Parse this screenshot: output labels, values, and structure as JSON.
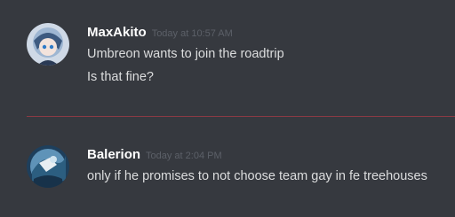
{
  "messages": [
    {
      "username": "MaxAkito",
      "timestamp": "Today at 10:57 AM",
      "lines": [
        "Umbreon wants to join the roadtrip",
        "Is that fine?"
      ],
      "avatar": "anime-character-avatar"
    },
    {
      "username": "Balerion",
      "timestamp": "Today at 2:04 PM",
      "lines": [
        "only if he promises to not choose team gay in fe treehouses"
      ],
      "avatar": "fantasy-art-avatar"
    }
  ],
  "colors": {
    "background": "#36393f",
    "username": "#ffffff",
    "timestamp": "#5c6068",
    "message_text": "#dcddde",
    "new_message_divider": "#8a3a44"
  }
}
